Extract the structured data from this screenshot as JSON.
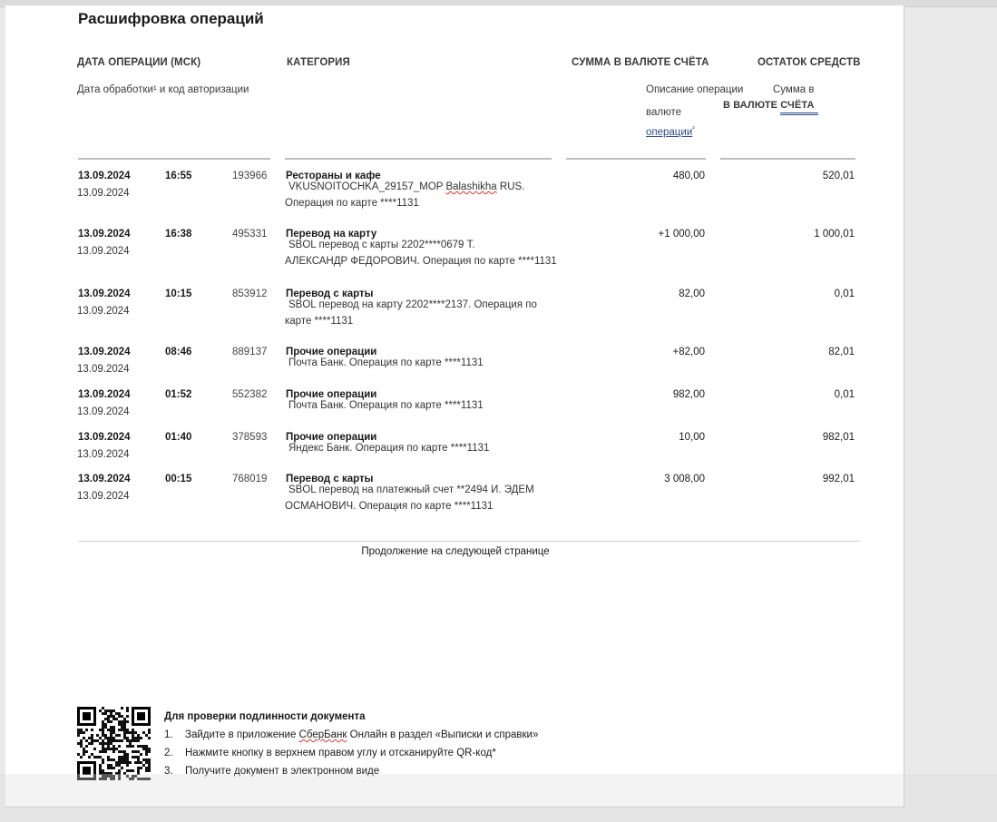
{
  "title": "Расшифровка операций",
  "headers": {
    "date": "ДАТА ОПЕРАЦИИ (МСК)",
    "category": "КАТЕГОРИЯ",
    "amount": "СУММА В ВАЛЮТЕ СЧЁТА",
    "balance": "ОСТАТОК СРЕДСТВ",
    "sub_date": "Дата обработки¹ и код авторизации",
    "sub_desc": "Описание операции",
    "sub_amount_op_1": "Сумма в",
    "sub_amount_op_2": "валюте",
    "sub_amount_op_3": "операции",
    "sub_amount_op_sup": "²",
    "sub_balance": "В ВАЛЮТЕ СЧЁТА"
  },
  "operations": [
    {
      "date": "13.09.2024",
      "time": "16:55",
      "code": "193966",
      "proc_date": "13.09.2024",
      "category": "Рестораны и кафе",
      "desc_1": "VKUSNOITOCHKA_29157_MOP ",
      "desc_spell": "Balashikha",
      "desc_2": " RUS.",
      "desc_3": "Операция по карте ****1131",
      "amount": "480,00",
      "balance": "520,01"
    },
    {
      "date": "13.09.2024",
      "time": "16:38",
      "code": "495331",
      "proc_date": "13.09.2024",
      "category": "Перевод на карту",
      "desc_1": "SBOL перевод с карты 2202****0679 Т.",
      "desc_3": "АЛЕКСАНДР ФЕДОРОВИЧ. Операция по карте ****1131",
      "amount": "+1 000,00",
      "balance": "1 000,01"
    },
    {
      "date": "13.09.2024",
      "time": "10:15",
      "code": "853912",
      "proc_date": "13.09.2024",
      "category": "Перевод с карты",
      "desc_1": "SBOL перевод на карту 2202****2137. Операция по",
      "desc_3": "карте ****1131",
      "amount": "82,00",
      "balance": "0,01"
    },
    {
      "date": "13.09.2024",
      "time": "08:46",
      "code": "889137",
      "proc_date": "13.09.2024",
      "category": "Прочие операции",
      "desc_1": "Почта Банк. Операция по карте ****1131",
      "amount": "+82,00",
      "balance": "82,01"
    },
    {
      "date": "13.09.2024",
      "time": "01:52",
      "code": "552382",
      "proc_date": "13.09.2024",
      "category": "Прочие операции",
      "desc_1": "Почта Банк. Операция по карте ****1131",
      "amount": "982,00",
      "balance": "0,01"
    },
    {
      "date": "13.09.2024",
      "time": "01:40",
      "code": "378593",
      "proc_date": "13.09.2024",
      "category": "Прочие операции",
      "desc_1": "Яндекс Банк. Операция по карте ****1131",
      "amount": "10,00",
      "balance": "982,01"
    },
    {
      "date": "13.09.2024",
      "time": "00:15",
      "code": "768019",
      "proc_date": "13.09.2024",
      "category": "Перевод с карты",
      "desc_1": "SBOL перевод на платежный счет **2494 И. ЭДЕМ",
      "desc_3": "ОСМАНОВИЧ. Операция по карте ****1131",
      "amount": "3 008,00",
      "balance": "992,01"
    }
  ],
  "continued": "Продолжение на следующей странице",
  "verify": {
    "heading": "Для проверки подлинности документа",
    "steps": [
      {
        "n": "1.",
        "text_a": "Зайдите в приложение ",
        "text_spell": "СберБанк",
        "text_b": " Онлайн в раздел «Выписки и справки»"
      },
      {
        "n": "2.",
        "text_a": "Нажмите кнопку в верхнем правом углу и отсканируйте QR-код*",
        "text_spell": "",
        "text_b": ""
      },
      {
        "n": "3.",
        "text_a": "Получите документ в электронном виде",
        "text_spell": "",
        "text_b": ""
      }
    ]
  }
}
